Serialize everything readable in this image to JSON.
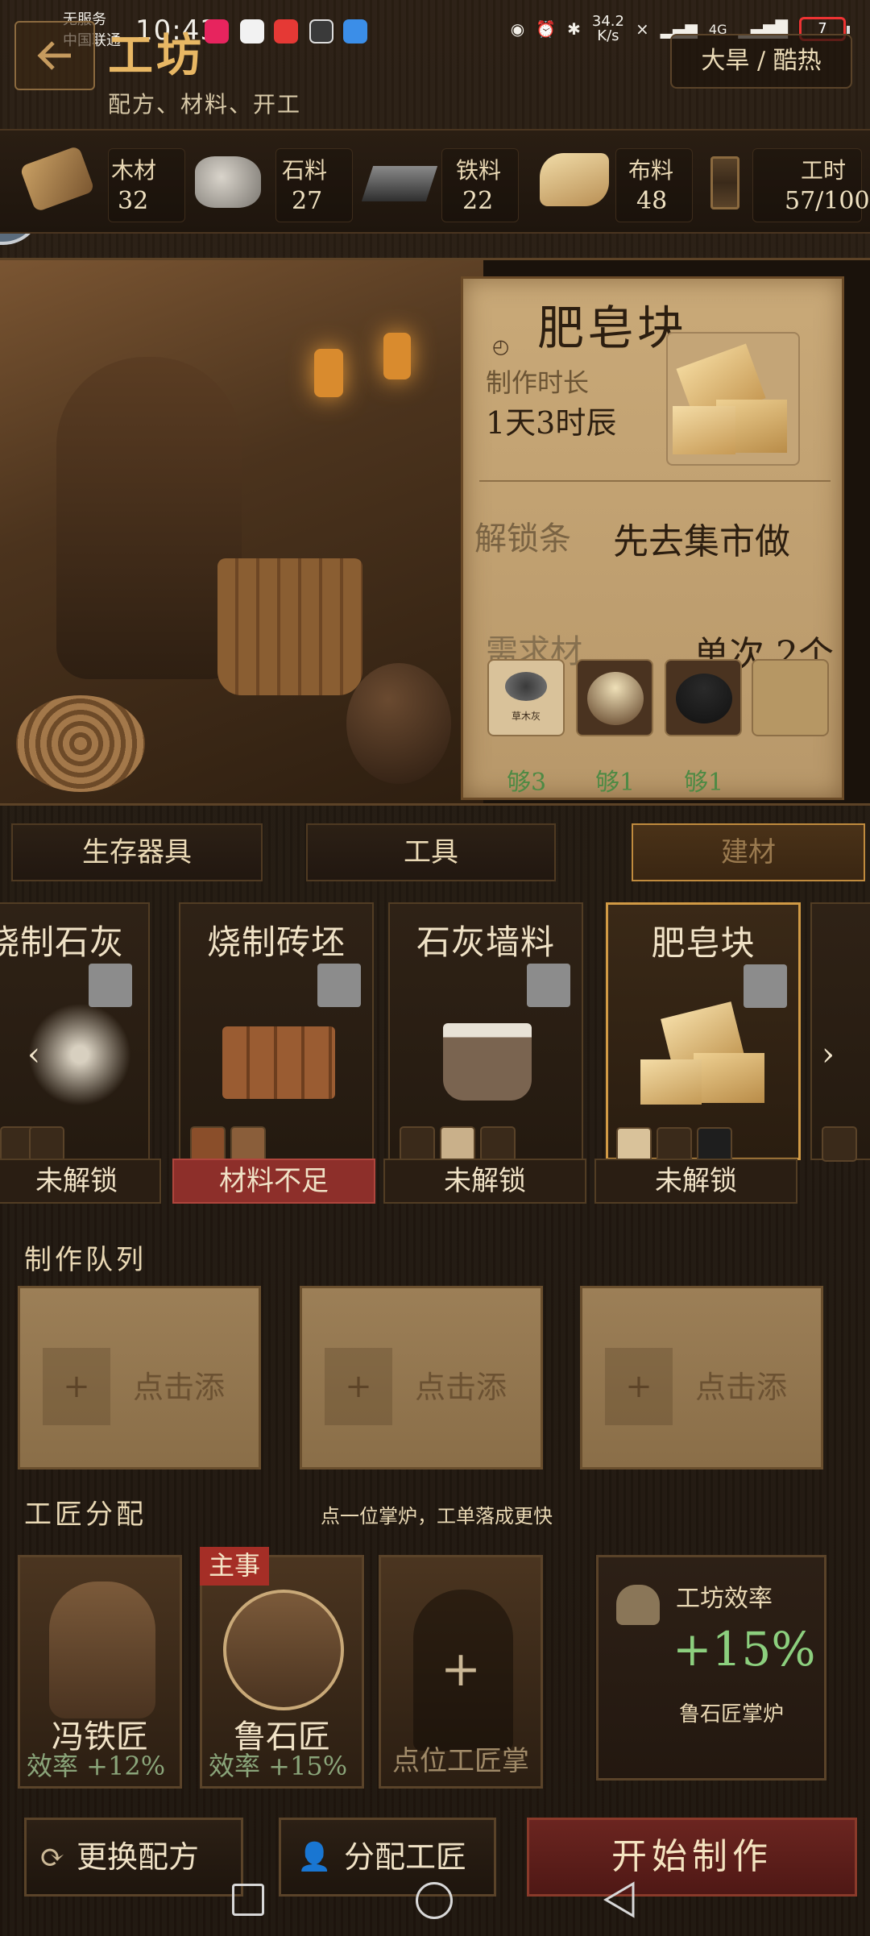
{
  "status_bar": {
    "carrier_line1": "无服务",
    "carrier_line2": "中国联通",
    "time": "10:43",
    "net_speed_value": "34.2",
    "net_speed_unit": "K/s",
    "network": "4G",
    "battery": "7"
  },
  "header": {
    "title": "工坊",
    "subtitle": "配方、材料、开工",
    "weather": "大旱 / 酷热"
  },
  "resources": [
    {
      "label": "木材",
      "value": "32"
    },
    {
      "label": "石料",
      "value": "27"
    },
    {
      "label": "铁料",
      "value": "22"
    },
    {
      "label": "布料",
      "value": "48"
    },
    {
      "label": "工时",
      "value": "57/100"
    }
  ],
  "recipe_detail": {
    "name": "肥皂块",
    "duration_label": "制作时长",
    "duration_value": "1天3时辰",
    "unlock_label": "解锁条",
    "unlock_value": "先去集市做",
    "need_label": "需求材",
    "need_value": "单次 2个",
    "material_counts": [
      "够3",
      "够1",
      "够1"
    ],
    "material_tag": "草木灰"
  },
  "tabs": [
    "生存器具",
    "工具",
    "建材"
  ],
  "recipes": [
    {
      "name": "烧制石灰",
      "status": "未解锁"
    },
    {
      "name": "烧制砖坯",
      "status": "材料不足"
    },
    {
      "name": "石灰墙料",
      "status": "未解锁"
    },
    {
      "name": "肥皂块",
      "status": "未解锁"
    }
  ],
  "queue": {
    "title": "制作队列",
    "slot_hint": "点击添"
  },
  "artisans": {
    "title": "工匠分配",
    "hint": "点一位掌炉，工单落成更快",
    "list": [
      {
        "name": "冯铁匠",
        "efficiency": "效率 +12%"
      },
      {
        "name": "鲁石匠",
        "efficiency": "效率 +15%",
        "badge": "主事"
      }
    ],
    "empty_slot": "点位工匠掌",
    "efficiency_panel": {
      "title": "工坊效率",
      "value": "+15%",
      "note": "鲁石匠掌炉"
    }
  },
  "actions": {
    "change_recipe": "更换配方",
    "assign_artisan": "分配工匠",
    "start": "开始制作"
  },
  "colors": {
    "accent_gold": "#e8b764",
    "positive_green": "#8ccf7e",
    "warning_red": "#8d2f2a"
  }
}
